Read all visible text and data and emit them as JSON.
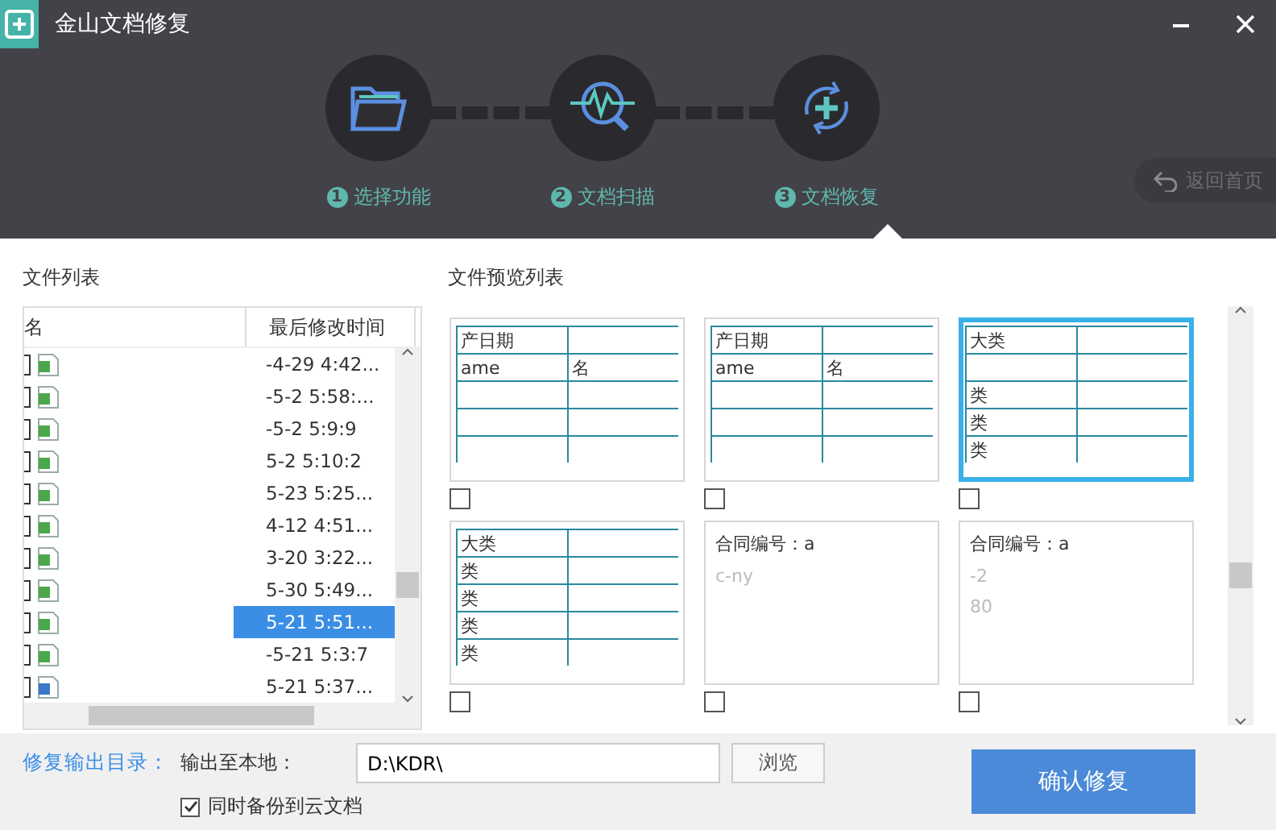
{
  "window": {
    "title": "金山文档修复"
  },
  "steps": [
    {
      "number": "1",
      "label": "选择功能",
      "kind": "folder"
    },
    {
      "number": "2",
      "label": "文档扫描",
      "kind": "scan"
    },
    {
      "number": "3",
      "label": "文档恢复",
      "kind": "restore"
    }
  ],
  "back_button": "返回首页",
  "file_list": {
    "title": "文件列表",
    "columns": [
      "名",
      "最后修改时间"
    ],
    "rows": [
      {
        "kind": "sheet",
        "time": "-4-29 4:42...",
        "selected": false,
        "checked": false
      },
      {
        "kind": "sheet",
        "time": "-5-2 5:58:...",
        "selected": false,
        "checked": false
      },
      {
        "kind": "sheet",
        "time": "-5-2 5:9:9",
        "selected": false,
        "checked": false
      },
      {
        "kind": "sheet",
        "time": "5-2 5:10:2",
        "selected": false,
        "checked": false
      },
      {
        "kind": "sheet",
        "time": "5-23 5:25...",
        "selected": false,
        "checked": false
      },
      {
        "kind": "sheet",
        "time": "4-12 4:51...",
        "selected": false,
        "checked": false
      },
      {
        "kind": "sheet",
        "time": "3-20 3:22...",
        "selected": false,
        "checked": false
      },
      {
        "kind": "sheet",
        "time": "5-30 5:49...",
        "selected": false,
        "checked": false
      },
      {
        "kind": "sheet",
        "time": "5-21 5:51...",
        "selected": true,
        "checked": false
      },
      {
        "kind": "sheet",
        "time": "-5-21 5:3:7",
        "selected": false,
        "checked": false
      },
      {
        "kind": "doc",
        "time": "5-21 5:37...",
        "selected": false,
        "checked": false
      }
    ]
  },
  "preview": {
    "title": "文件预览列表",
    "cards": [
      {
        "kind": "table",
        "selected": false,
        "checked": false,
        "rows": [
          [
            "产日期",
            ""
          ],
          [
            "ame",
            "名"
          ],
          [
            "",
            ""
          ],
          [
            "",
            ""
          ],
          [
            "",
            ""
          ]
        ]
      },
      {
        "kind": "table",
        "selected": false,
        "checked": false,
        "rows": [
          [
            "产日期",
            ""
          ],
          [
            "ame",
            "名"
          ],
          [
            "",
            ""
          ],
          [
            "",
            ""
          ],
          [
            "",
            ""
          ]
        ]
      },
      {
        "kind": "table",
        "selected": true,
        "checked": false,
        "rows": [
          [
            "大类",
            ""
          ],
          [
            "",
            ""
          ],
          [
            "类",
            ""
          ],
          [
            "类",
            ""
          ],
          [
            "类",
            ""
          ]
        ]
      },
      {
        "kind": "table",
        "selected": false,
        "checked": false,
        "rows": [
          [
            "大类",
            ""
          ],
          [
            "类",
            ""
          ],
          [
            "类",
            ""
          ],
          [
            "类",
            ""
          ],
          [
            "类",
            ""
          ]
        ]
      },
      {
        "kind": "text",
        "selected": false,
        "checked": false,
        "lines": [
          "合同编号：a",
          "c-ny"
        ]
      },
      {
        "kind": "text",
        "selected": false,
        "checked": false,
        "lines": [
          "合同编号：a",
          "-2",
          "80"
        ]
      }
    ]
  },
  "output": {
    "label": "修复输出目录：",
    "local_label": "输出至本地：",
    "path": "D:\\KDR\\",
    "browse": "浏览",
    "backup": {
      "label": "同时备份到云文档",
      "checked": true
    },
    "confirm": "确认修复"
  }
}
